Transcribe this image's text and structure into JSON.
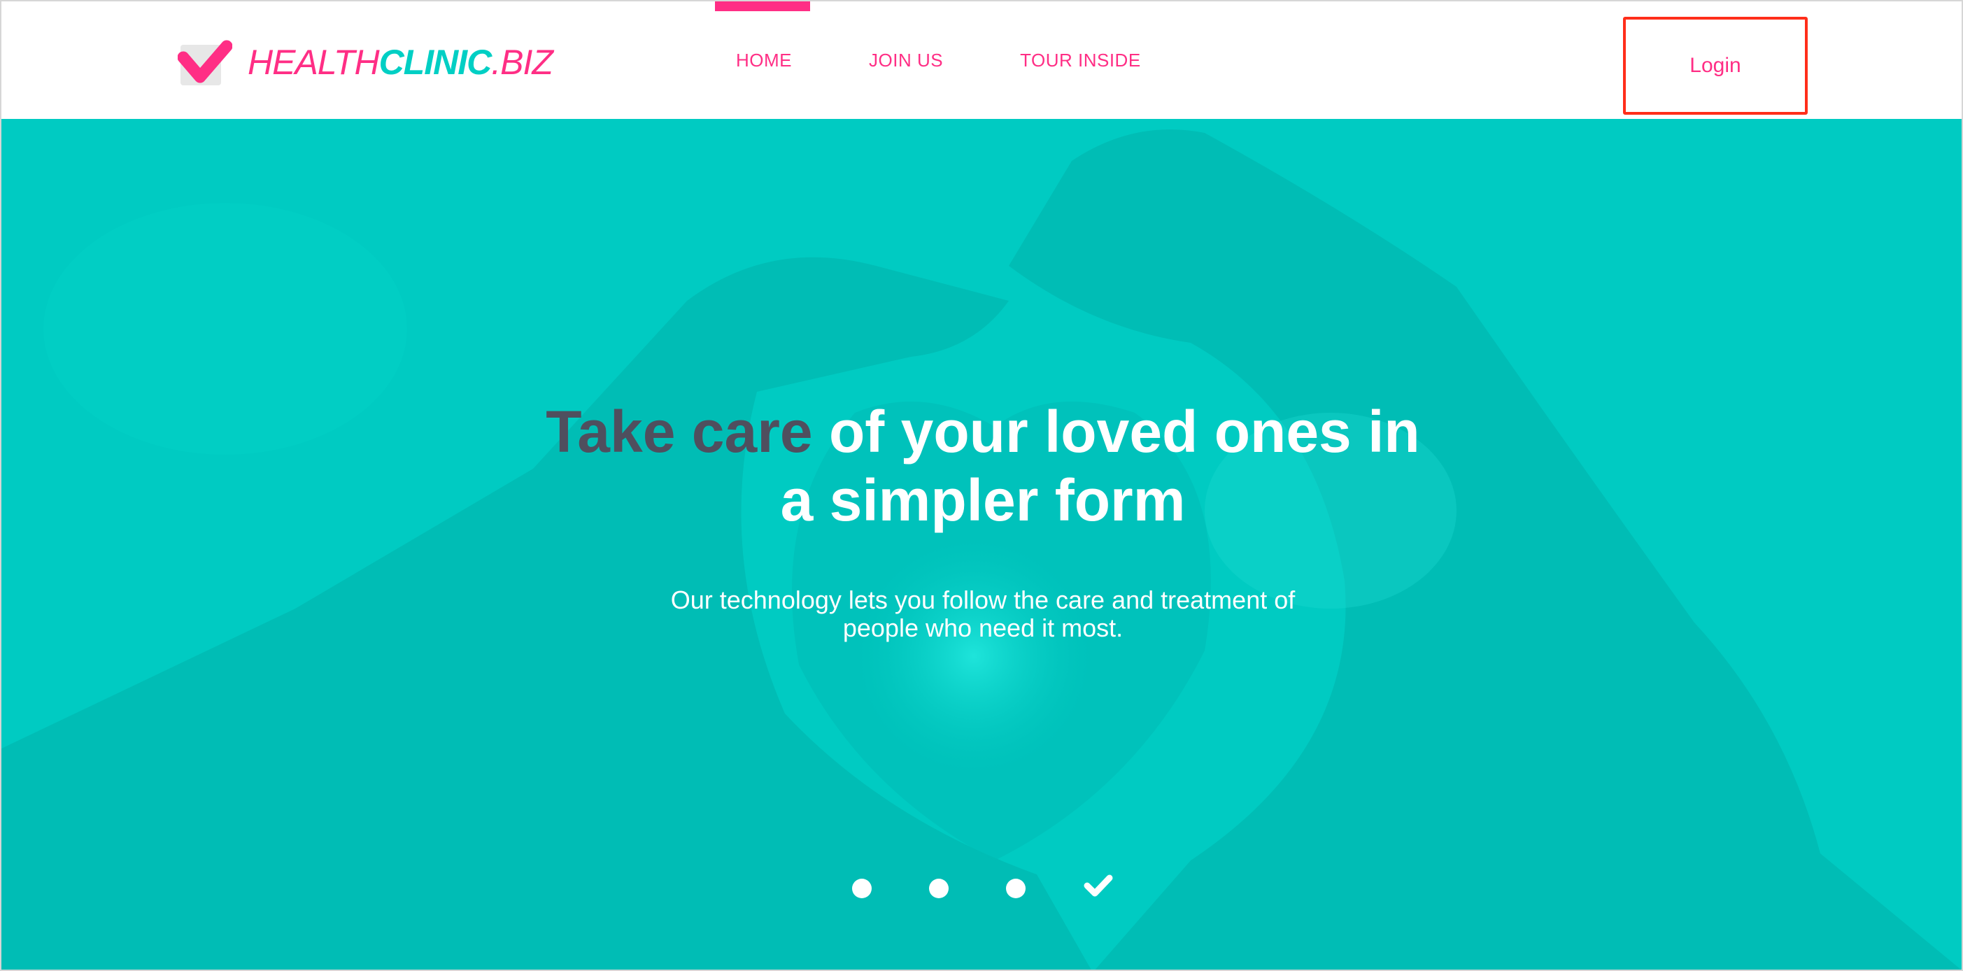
{
  "colors": {
    "brand_pink": "#ff2e85",
    "brand_teal": "#00cfc4",
    "hero_background": "#00cbc2",
    "accent_text": "#4f4f5e",
    "login_outline": "#ff2e1a"
  },
  "logo": {
    "icon": "heart-check-icon",
    "text_part1": "HEALTH",
    "text_part2": "CLINIC",
    "text_part3": ".BIZ"
  },
  "nav": {
    "items": [
      {
        "label": "HOME",
        "active": true
      },
      {
        "label": "JOIN US",
        "active": false
      },
      {
        "label": "TOUR INSIDE",
        "active": false
      }
    ]
  },
  "header": {
    "login_label": "Login"
  },
  "hero": {
    "background_image": "hands-heart-shape",
    "headline_accent": "Take care",
    "headline_line1_rest": " of your loved ones in",
    "headline_line2": "a simpler form",
    "subtext_line1": "Our technology lets you follow the care and treatment of",
    "subtext_line2": "people who need it most."
  },
  "carousel": {
    "count": 4,
    "active_index": 3,
    "active_indicator_icon": "checkmark-icon"
  }
}
